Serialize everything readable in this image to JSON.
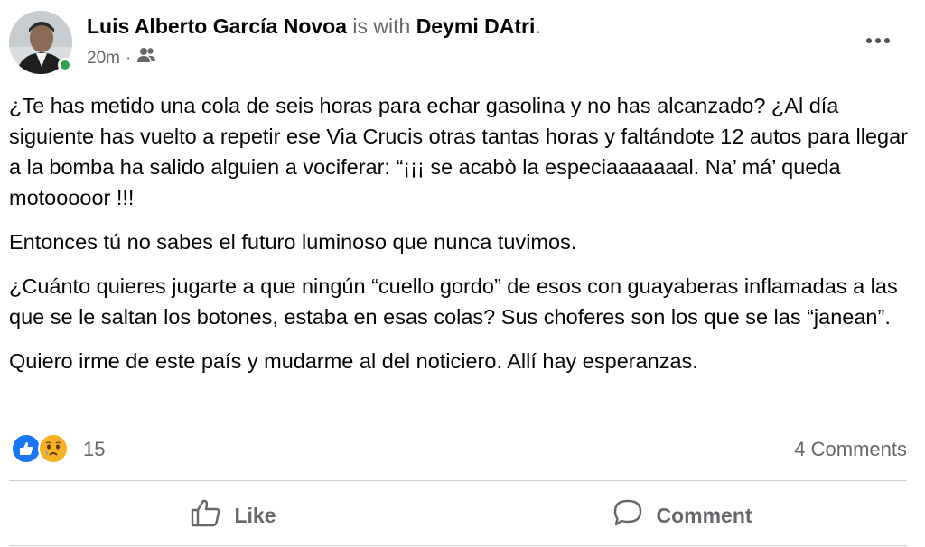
{
  "post": {
    "author": "Luis Alberto García Novoa",
    "with_text": "is with",
    "tagged": "Deymi DAtri",
    "period": ".",
    "time": "20m",
    "dot": "·",
    "audience_icon": "friends-icon"
  },
  "content": {
    "paragraphs": [
      "¿Te has metido una cola de seis horas para echar gasolina y no has alcanzado? ¿Al día siguiente has vuelto a repetir ese Via Crucis otras tantas horas y faltándote 12 autos para llegar a la bomba ha salido alguien a vociferar: “¡¡¡ se acabò la especiaaaaaaal. Na’ má’ queda motooooor !!!",
      "Entonces tú no sabes el futuro luminoso que nunca tuvimos.",
      "¿Cuánto quieres jugarte a que ningún “cuello gordo” de esos con guayaberas inflamadas a las que se le saltan los botones, estaba en esas colas? Sus choferes son los que se las “janean”.",
      "Quiero irme de este país y mudarme al del noticiero. Allí hay esperanzas."
    ]
  },
  "reactions": {
    "count": "15",
    "icons": [
      "like-reaction-icon",
      "sad-reaction-icon"
    ],
    "comments": "4 Comments"
  },
  "actions": {
    "like_label": "Like",
    "comment_label": "Comment"
  },
  "colors": {
    "like_blue": "#1877f2",
    "sad_yellow": "#f7b125",
    "online_green": "#31a24c",
    "secondary_text": "#65676b"
  }
}
